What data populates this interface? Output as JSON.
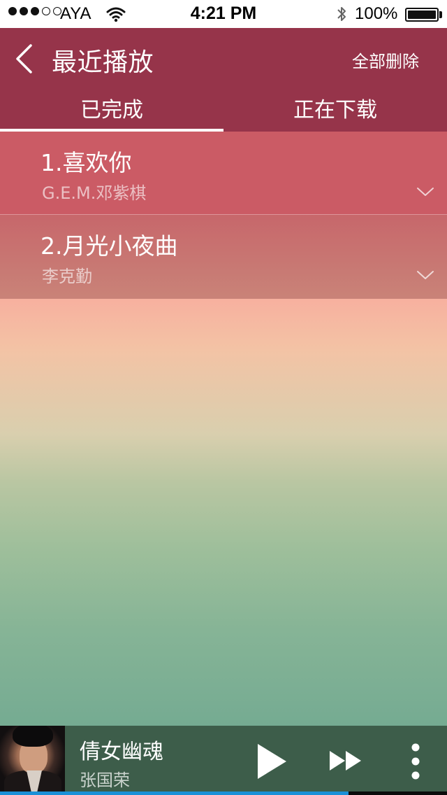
{
  "status_bar": {
    "carrier": "AYA",
    "time": "4:21 PM",
    "battery": "100%",
    "signal_filled_dots": 3,
    "signal_total_dots": 5
  },
  "header": {
    "title": "最近播放",
    "delete_all": "全部删除"
  },
  "tabs": [
    {
      "label": "已完成",
      "active": true
    },
    {
      "label": "正在下载",
      "active": false
    }
  ],
  "songs": [
    {
      "title": "1.喜欢你",
      "artist": "G.E.M.邓紫棋"
    },
    {
      "title": "2.月光小夜曲",
      "artist": "李克勤"
    }
  ],
  "player": {
    "title": "倩女幽魂",
    "artist": "张国荣",
    "progress_fraction": 0.78
  },
  "colors": {
    "header": "#96344a",
    "row_1": "#cb5b65",
    "player_bar": "#3d5d4a",
    "progress_blue": "#1a90d7"
  },
  "icons": {
    "back": "chevron-left-icon",
    "expand": "chevron-down-icon",
    "play": "play-icon",
    "next": "fast-forward-icon",
    "more": "more-vertical-icon"
  }
}
